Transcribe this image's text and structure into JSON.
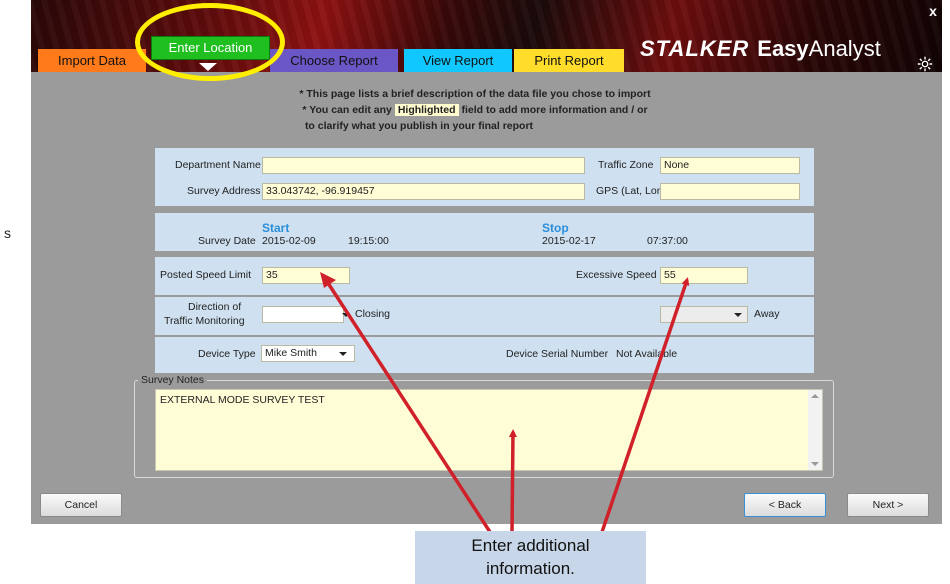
{
  "app": {
    "logo_brand": "STALKER",
    "logo_easy": "Easy",
    "logo_analyst": "Analyst",
    "close_label": "x"
  },
  "tabs": [
    {
      "label": "Import Data",
      "color": "#ff7a1a"
    },
    {
      "label": "Enter Location",
      "color": "#1fbf1f",
      "active": true
    },
    {
      "label": "Choose Report",
      "color": "#6a56c4"
    },
    {
      "label": "View Report",
      "color": "#10c8ff"
    },
    {
      "label": "Print Report",
      "color": "#ffdd2a"
    }
  ],
  "info": {
    "line1": "* This page lists a brief description of the data file you chose to import",
    "line2_pre": "* You can edit any",
    "line2_hl": "Highlighted",
    "line2_post": "field to add more information and / or",
    "line3": "to clarify what you publish in your final report"
  },
  "form": {
    "department_label": "Department Name",
    "department_value": "",
    "traffic_zone_label": "Traffic Zone",
    "traffic_zone_value": "None",
    "survey_address_label": "Survey Address",
    "survey_address_value": "33.043742, -96.919457",
    "gps_label": "GPS (Lat, Long)",
    "gps_value": "",
    "start_heading": "Start",
    "stop_heading": "Stop",
    "survey_date_label": "Survey Date",
    "start_date": "2015-02-09",
    "start_time": "19:15:00",
    "stop_date": "2015-02-17",
    "stop_time": "07:37:00",
    "posted_speed_label": "Posted Speed Limit",
    "posted_speed_value": "35",
    "excessive_speed_label": "Excessive Speed",
    "excessive_speed_value": "55",
    "direction_label_1": "Direction of",
    "direction_label_2": "Traffic Monitoring",
    "closing_label": "Closing",
    "away_label": "Away",
    "device_type_label": "Device Type",
    "device_type_value": "Mike Smith",
    "serial_label": "Device Serial Number",
    "serial_value": "Not Available"
  },
  "notes": {
    "group_title": "Survey Notes",
    "text": "EXTERNAL MODE SURVEY TEST"
  },
  "buttons": {
    "cancel": "Cancel",
    "back": "< Back",
    "next": "Next >"
  },
  "callout": {
    "line1": "Enter additional",
    "line2": "information."
  },
  "side_letter": "s",
  "colors": {
    "highlight_ring": "#ffee00",
    "arrow": "#d0202a",
    "field_highlight": "#fffdd6",
    "section_bg": "#cfe0f0"
  }
}
